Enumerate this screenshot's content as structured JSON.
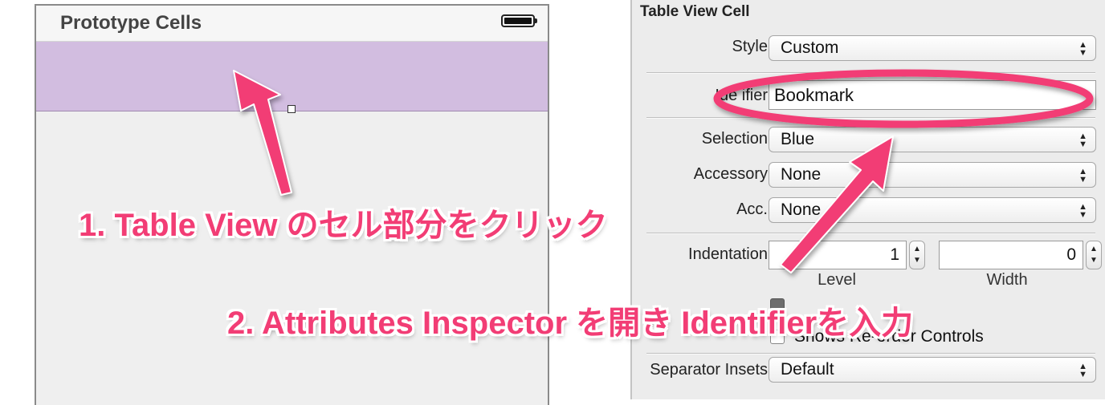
{
  "storyboard": {
    "section_title": "Prototype Cells"
  },
  "inspector": {
    "title": "Table View Cell",
    "style": {
      "label": "Style",
      "value": "Custom"
    },
    "identifier": {
      "label": "Identifier",
      "visible_label": "Ide      ifier",
      "value": "Bookmark"
    },
    "selection": {
      "label": "Selection",
      "value": "Blue"
    },
    "accessory": {
      "label": "Accessory",
      "value": "None"
    },
    "editing_acc": {
      "label": "Editing Acc.",
      "visible_label": "Acc.",
      "value": "None"
    },
    "indentation": {
      "label": "Indentation",
      "level_value": "1",
      "width_value": "0",
      "level_label": "Level",
      "width_label": "Width"
    },
    "reorder": {
      "label": "Shows Re-order Controls",
      "checked": false
    },
    "separator_insets": {
      "label": "Separator Insets",
      "value": "Default"
    }
  },
  "annotations": {
    "step1": "1. Table View のセル部分をクリック",
    "step2": "2. Attributes Inspector を開き Identifierを入力",
    "color": "#f23d75"
  },
  "icons": [
    "battery-icon",
    "popup-arrows-icon",
    "stepper-icon",
    "resize-handle-icon",
    "arrow-annotation-icon",
    "ellipse-highlight"
  ]
}
